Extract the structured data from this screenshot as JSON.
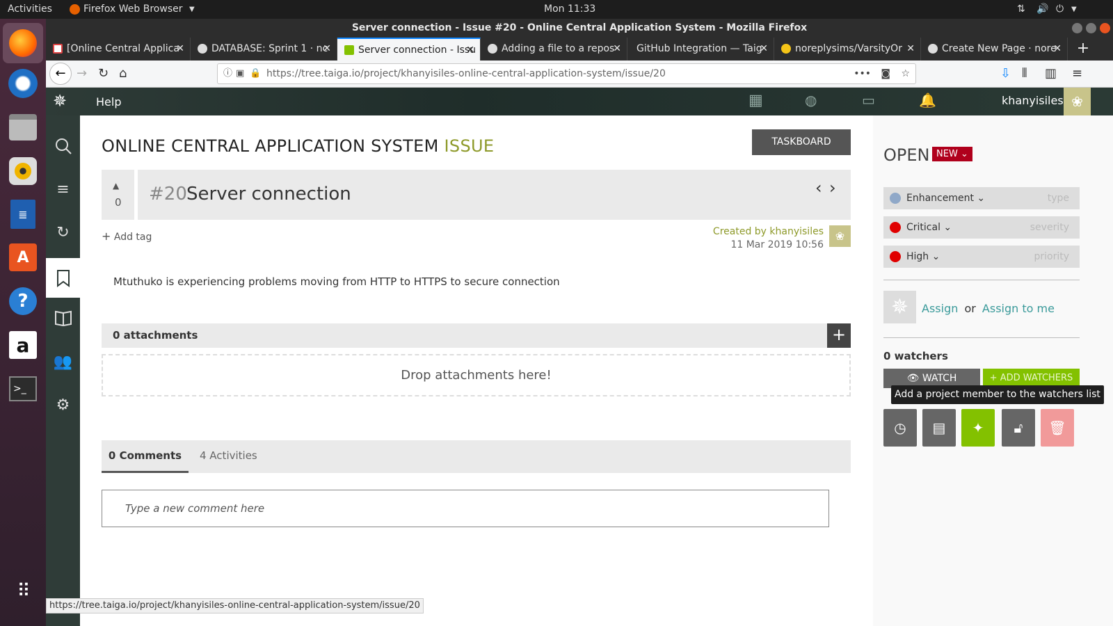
{
  "os": {
    "activities": "Activities",
    "app_menu": "Firefox Web Browser",
    "clock": "Mon 11:33"
  },
  "window": {
    "title": "Server connection - Issue #20 - Online Central Application System - Mozilla Firefox"
  },
  "tabs": [
    {
      "label": "[Online Central Applica",
      "icon": "gmail-icon",
      "active": false
    },
    {
      "label": "DATABASE: Sprint 1 · nc",
      "icon": "github-icon",
      "active": false
    },
    {
      "label": "Server connection - Issu",
      "icon": "taiga-icon",
      "active": true
    },
    {
      "label": "Adding a file to a repos",
      "icon": "github-icon",
      "active": false
    },
    {
      "label": "GitHub Integration — Taig",
      "icon": "none",
      "active": false
    },
    {
      "label": "noreplysims/VarsityOr",
      "icon": "emoji-icon",
      "active": false
    },
    {
      "label": "Create New Page · nore",
      "icon": "github-icon",
      "active": false
    }
  ],
  "navbar": {
    "url": "https://tree.taiga.io/project/khanyisiles-online-central-application-system/issue/20"
  },
  "taiga": {
    "help": "Help",
    "username": "khanyisiles",
    "page_title": "ONLINE CENTRAL APPLICATION SYSTEM",
    "page_title_suffix": "ISSUE",
    "taskboard_button": "TASKBOARD",
    "votes": "0",
    "issue_ref": "#20",
    "issue_subject": "Server connection",
    "add_tag": "Add tag",
    "created_by": "Created by khanyisiles",
    "created_date": "11 Mar 2019 10:56",
    "description": "Mtuthuko is experiencing problems moving from HTTP to HTTPS to secure connection",
    "attachments_label": "0 attachments",
    "drop_attachments": "Drop attachments here!",
    "comments_tab": "0 Comments",
    "activities_tab": "4 Activities",
    "comment_placeholder": "Type a new comment here"
  },
  "right_panel": {
    "status": "OPEN",
    "status_badge": "NEW",
    "type": {
      "value": "Enhancement",
      "hint": "type",
      "color": "#8fa8c8"
    },
    "severity": {
      "value": "Critical",
      "hint": "severity",
      "color": "#e00000"
    },
    "priority": {
      "value": "High",
      "hint": "priority",
      "color": "#e00000"
    },
    "assign": "Assign",
    "or": "or",
    "assign_to_me": "Assign to me",
    "watchers": "0 watchers",
    "watch_button": "WATCH",
    "add_watchers_button": "+ ADD WATCHERS",
    "tooltip": "Add a project member to the watchers list"
  },
  "statusbar": {
    "url": "https://tree.taiga.io/project/khanyisiles-online-central-application-system/issue/20"
  },
  "colors": {
    "taiga_green": "#83c100",
    "olive_text": "#8e9a2a",
    "badge_red": "#b0001c",
    "delete_pink": "#f19a9a"
  }
}
